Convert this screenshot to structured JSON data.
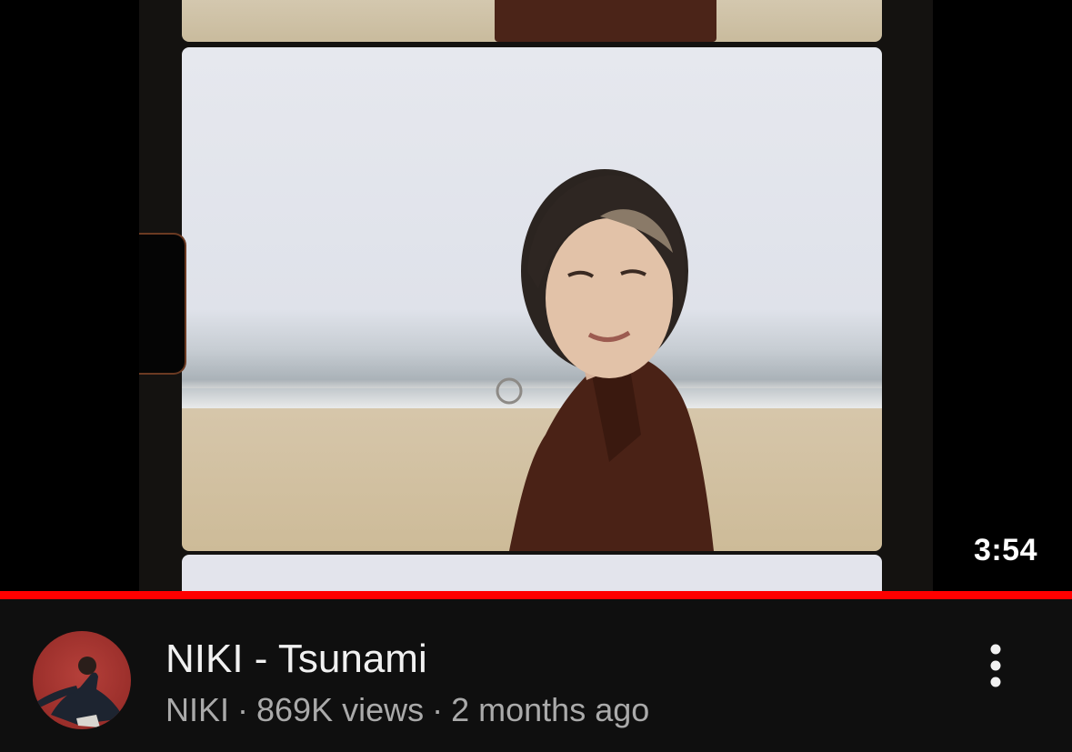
{
  "video": {
    "duration": "3:54",
    "progress_fraction": 1.0,
    "accent_color": "#ff0000"
  },
  "meta": {
    "title": "NIKI - Tsunami",
    "channel": "NIKI",
    "views": "869K views",
    "age": "2 months ago",
    "separator": "·"
  },
  "icons": {
    "more": "more-vertical-icon"
  }
}
